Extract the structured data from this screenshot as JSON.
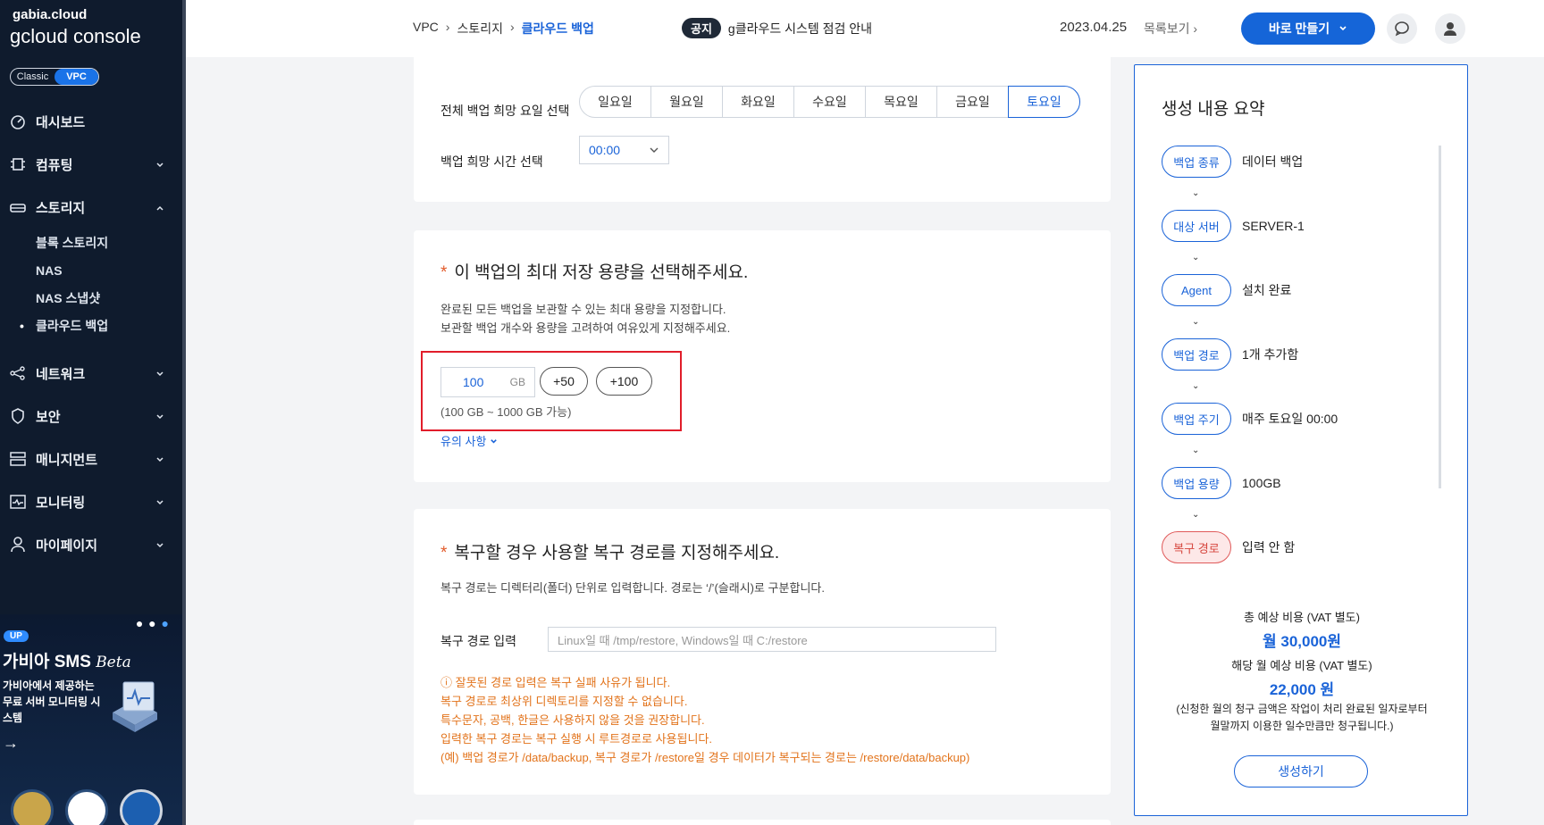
{
  "sidebar": {
    "brand_small": "gabia.cloud",
    "brand_big": "gcloud console",
    "mode_classic": "Classic",
    "mode_vpc": "VPC",
    "menu": [
      {
        "label": "대시보드"
      },
      {
        "label": "컴퓨팅"
      },
      {
        "label": "스토리지"
      },
      {
        "label": "네트워크"
      },
      {
        "label": "보안"
      },
      {
        "label": "매니지먼트"
      },
      {
        "label": "모니터링"
      },
      {
        "label": "마이페이지"
      }
    ],
    "storage_sub": [
      "블록 스토리지",
      "NAS",
      "NAS 스냅샷",
      "클라우드 백업"
    ],
    "promo": {
      "badge": "UP",
      "title": "가비아 SMS",
      "title_suffix": "Beta",
      "desc": "가비아에서 제공하는 무료 서버 모니터링 시스템"
    },
    "icons": [
      "dashboard-icon",
      "chip-icon",
      "storage-icon",
      "network-icon",
      "shield-icon",
      "management-icon",
      "monitor-icon",
      "user-icon"
    ]
  },
  "header": {
    "breadcrumb": [
      "VPC",
      "스토리지",
      "클라우드 백업"
    ],
    "notice_tag": "공지",
    "notice_text": "g클라우드 시스템 점검 안내",
    "date": "2023.04.25",
    "list_link": "목록보기",
    "create_now": "바로 만들기"
  },
  "schedule": {
    "day_label": "전체 백업 희망 요일 선택",
    "days": [
      "일요일",
      "월요일",
      "화요일",
      "수요일",
      "목요일",
      "금요일",
      "토요일"
    ],
    "selected_day": "토요일",
    "time_label": "백업 희망 시간 선택",
    "time_value": "00:00"
  },
  "capacity": {
    "title": "이 백업의 최대 저장 용량을 선택해주세요.",
    "desc1": "완료된 모든 백업을 보관할 수 있는 최대 용량을 지정합니다.",
    "desc2": "보관할 백업 개수와 용량을 고려하여 여유있게 지정해주세요.",
    "value": "100",
    "unit": "GB",
    "plus50": "+50",
    "plus100": "+100",
    "range": "(100 GB ~ 1000 GB 가능)",
    "caution_link": "유의 사항"
  },
  "restore": {
    "title": "복구할 경우 사용할 복구 경로를 지정해주세요.",
    "desc": "복구 경로는 디렉터리(폴더) 단위로 입력합니다. 경로는 ‘/’(슬래시)로 구분합니다.",
    "input_label": "복구 경로 입력",
    "placeholder": "Linux일 때 /tmp/restore, Windows일 때 C:/restore",
    "warnings": [
      "ⓘ 잘못된 경로 입력은 복구 실패 사유가 됩니다.",
      "복구 경로로 최상위 디렉토리를 지정할 수 없습니다.",
      "특수문자, 공백, 한글은 사용하지 않을 것을 권장합니다.",
      "입력한 복구 경로는 복구 실행 시 루트경로로 사용됩니다.",
      "(예) 백업 경로가 /data/backup, 복구 경로가 /restore일 경우 데이터가 복구되는 경로는 /restore/data/backup)"
    ]
  },
  "summary": {
    "title": "생성 내용 요약",
    "steps": [
      {
        "label": "백업 종류",
        "value": "데이터 백업",
        "status": "ok"
      },
      {
        "label": "대상 서버",
        "value": "SERVER-1",
        "status": "ok"
      },
      {
        "label": "Agent",
        "value": "설치 완료",
        "status": "ok"
      },
      {
        "label": "백업 경로",
        "value": "1개 추가함",
        "status": "ok"
      },
      {
        "label": "백업 주기",
        "value": "매주 토요일 00:00",
        "status": "ok"
      },
      {
        "label": "백업 용량",
        "value": "100GB",
        "status": "ok"
      },
      {
        "label": "복구 경로",
        "value": "입력 안 함",
        "status": "error"
      }
    ],
    "total_label": "총 예상 비용 (VAT 별도)",
    "total_value": "월 30,000원",
    "month_label": "해당 월 예상 비용 (VAT 별도)",
    "month_value": "22,000 원",
    "note1": "(신청한 월의 청구 금액은 작업이 처리 완료된 일자로부터",
    "note2": "월말까지 이용한 일수만큼만 청구됩니다.)",
    "create_button": "생성하기"
  },
  "colors": {
    "accent": "#1a63d8",
    "sidebar_bg": "#0f1b2d",
    "warning": "#e2731b",
    "highlight": "#e11d2a"
  }
}
